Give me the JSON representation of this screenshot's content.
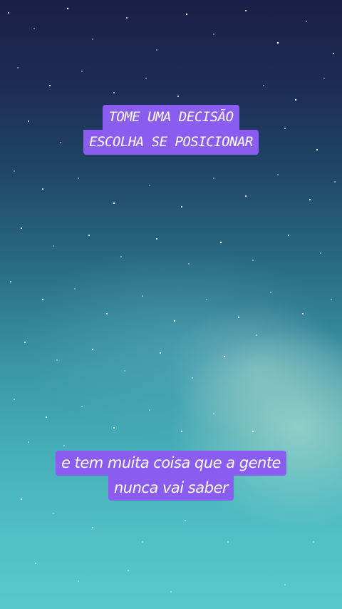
{
  "captions": {
    "top": {
      "line1": "TOME UMA DECISÃO",
      "line2": "ESCOLHA SE POSICIONAR"
    },
    "bottom": {
      "line1": "e tem muita coisa que a gente",
      "line2": "nunca vai saber"
    }
  },
  "colors": {
    "caption_background": "#8a5cf0",
    "caption_text": "#ffffff",
    "sky_top": "#1c1f45",
    "sky_bottom": "#57c8cb"
  }
}
